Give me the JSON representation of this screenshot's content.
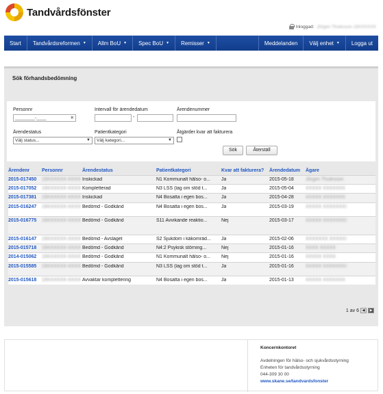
{
  "brand": {
    "name": "Tandvårdsfönster"
  },
  "login": {
    "label": "Inloggad:",
    "user": "Jörgen Thulesson 19XXXXXX"
  },
  "nav": {
    "left": [
      {
        "label": "Start",
        "dropdown": false
      },
      {
        "label": "Tandvårdsreformen",
        "dropdown": true
      },
      {
        "label": "Allm BoU",
        "dropdown": true
      },
      {
        "label": "Spec BoU",
        "dropdown": true
      },
      {
        "label": "Remisser",
        "dropdown": true
      }
    ],
    "right": [
      {
        "label": "Meddelanden",
        "dropdown": false
      },
      {
        "label": "Välj enhet",
        "dropdown": true
      },
      {
        "label": "Logga ut",
        "dropdown": false
      }
    ]
  },
  "search": {
    "title": "Sök förhandsbedömning",
    "personnr_label": "Personnr",
    "personnr_value": "________-____",
    "clear_symbol": "✕",
    "interval_label": "Intervall för ärendedatum",
    "interval_dash": "-",
    "arendenummer_label": "Ärendenummer",
    "status_label": "Ärendestatus",
    "status_selected": "Välj status...",
    "kategori_label": "Patientkategori",
    "kategori_selected": "Välj kategori...",
    "atgarder_label": "Åtgärder kvar att fakturera",
    "search_button": "Sök",
    "reset_button": "Återställ"
  },
  "table": {
    "headers": [
      "Ärendenr",
      "Personnr",
      "Ärendestatus",
      "Patientkategori",
      "Kvar att fakturera?",
      "Ärendedatum",
      "Ägare"
    ],
    "rows": [
      {
        "arendenr": "2015-017450",
        "personnr": "19XXXXXX-XXXX",
        "status": "Inskickad",
        "kategori": "N1 Kommunalt hälso- o...",
        "kvar": "Ja",
        "datum": "2015-05-18",
        "agare": "Jörgen Thulesson"
      },
      {
        "arendenr": "2015-017052",
        "personnr": "19XXXXXX-XXXX",
        "status": "Kompletterad",
        "kategori": "N3 LSS (lag om stöd t...",
        "kvar": "Ja",
        "datum": "2015-05-04",
        "agare": "XXXXX XXXXXXX"
      },
      {
        "arendenr": "2015-017381",
        "personnr": "19XXXXXX-XXXX",
        "status": "Inskickad",
        "kategori": "N4 Bosatta i egen bos...",
        "kvar": "Ja",
        "datum": "2015-04-28",
        "agare": "XXXXX XXXXXXX"
      },
      {
        "arendenr": "2015-016247",
        "personnr": "19XXXXXX-XXXX",
        "status": "Bedömd - Godkänd",
        "kategori": "N4 Bosatta i egen bos...",
        "kvar": "Ja",
        "datum": "2015-03-19",
        "agare": "XXXXX XXXXXXXX XXXXXXX"
      },
      {
        "arendenr": "2015-016775",
        "personnr": "19XXXXXX-XXXX",
        "status": "Bedömd - Godkänd",
        "kategori": "S11 Avvikande reaktio...",
        "kvar": "Nej",
        "datum": "2015-03-17",
        "agare": "XXXXX XXXXXXXX XXXXXXX"
      },
      {
        "arendenr": "2015-016147",
        "personnr": "19XXXXXX-XXXX",
        "status": "Bedömd - Avslaget",
        "kategori": "S2 Sjukdom i käkområd...",
        "kvar": "Ja",
        "datum": "2015-02-06",
        "agare": "XXXXXXX XXXXXXXX"
      },
      {
        "arendenr": "2015-015718",
        "personnr": "19XXXXXX-XXXX",
        "status": "Bedömd - Godkänd",
        "kategori": "N4:2 Psykisk störning...",
        "kvar": "Nej",
        "datum": "2015-01-16",
        "agare": "XXXX XXXXX"
      },
      {
        "arendenr": "2014-015062",
        "personnr": "19XXXXXX-XXXX",
        "status": "Bedömd - Godkänd",
        "kategori": "N1 Kommunalt hälso- o...",
        "kvar": "Nej",
        "datum": "2015-01-16",
        "agare": "XXXXX XXXX"
      },
      {
        "arendenr": "2015-015585",
        "personnr": "19XXXXXX-XXXX",
        "status": "Bedömd - Godkänd",
        "kategori": "N3 LSS (lag om stöd t...",
        "kvar": "Ja",
        "datum": "2015-01-16",
        "agare": "XXXXX XXXXXXXX XXXXXXX"
      },
      {
        "arendenr": "2015-015618",
        "personnr": "19XXXXXX-XXXX",
        "status": "Avvaktar komplettering",
        "kategori": "N4 Bosatta i egen bos...",
        "kvar": "Ja",
        "datum": "2015-01-13",
        "agare": "XXXXX XXXXXXX"
      }
    ]
  },
  "pager": {
    "text": "1 av 6",
    "prev": "◀",
    "next": "▶"
  },
  "footer": {
    "title": "Koncernkontoret",
    "line1": "Avdelningen för hälso- och sjukvårdsstyrning",
    "line2": "Enheten för tandvårdsstyrning",
    "phone": "044-309 30 00",
    "link": "www.skane.se/tandvardsfonster"
  },
  "colors": {
    "nav": "#1b4a9e",
    "link": "#1f56c1",
    "panel": "#e8e8e8"
  }
}
